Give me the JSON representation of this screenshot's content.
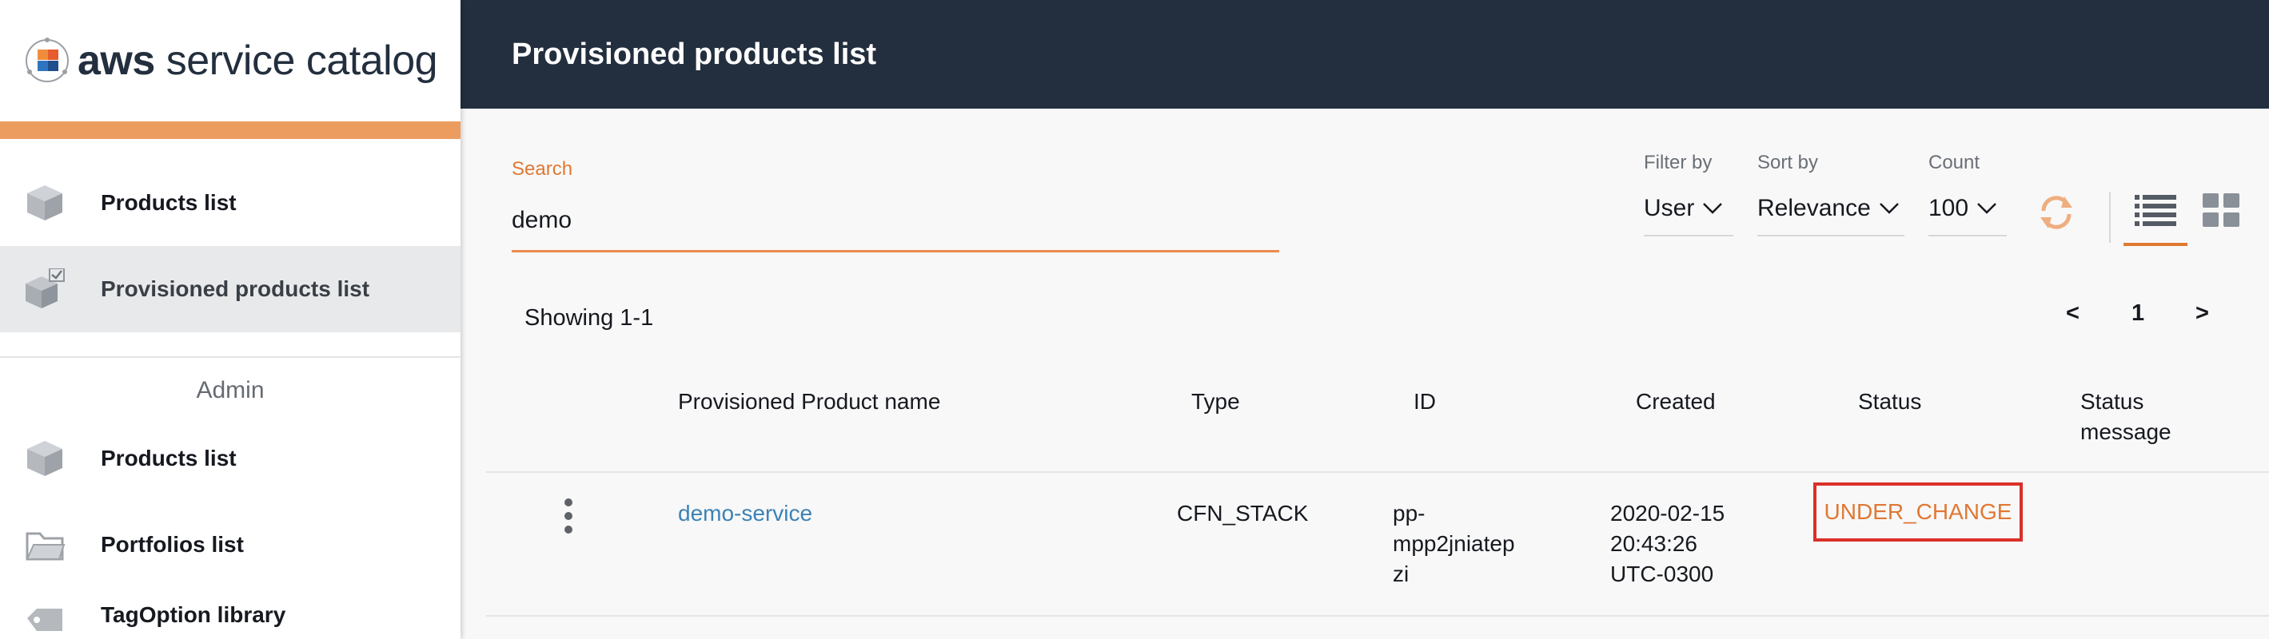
{
  "brand": {
    "bold": "aws",
    "rest": " service catalog"
  },
  "sidebar": {
    "items": [
      {
        "label": "Products list",
        "icon": "box-icon"
      },
      {
        "label": "Provisioned products list",
        "icon": "provisioned-box-icon"
      }
    ],
    "admin_label": "Admin",
    "admin_items": [
      {
        "label": "Products list",
        "icon": "box-icon"
      },
      {
        "label": "Portfolios list",
        "icon": "folder-icon"
      },
      {
        "label": "TagOption library",
        "icon": "tag-icon"
      }
    ]
  },
  "header": {
    "title": "Provisioned products list"
  },
  "search": {
    "label": "Search",
    "value": "demo"
  },
  "filters": {
    "filter_by": {
      "label": "Filter by",
      "value": "User"
    },
    "sort_by": {
      "label": "Sort by",
      "value": "Relevance"
    },
    "count": {
      "label": "Count",
      "value": "100"
    }
  },
  "results": {
    "showing": "Showing 1-1"
  },
  "pagination": {
    "prev": "<",
    "page": "1",
    "next": ">"
  },
  "table": {
    "headers": {
      "name": "Provisioned Product name",
      "type": "Type",
      "id": "ID",
      "created": "Created",
      "status": "Status",
      "status_message_1": "Status",
      "status_message_2": "message"
    },
    "rows": [
      {
        "name": "demo-service",
        "type": "CFN_STACK",
        "id_1": "pp-",
        "id_2": "mpp2jniatep",
        "id_3": "zi",
        "created_1": "2020-02-15",
        "created_2": "20:43:26",
        "created_3": "UTC-0300",
        "status": "UNDER_CHANGE",
        "status_message": ""
      }
    ]
  },
  "colors": {
    "header_bg": "#232f3e",
    "accent_orange": "#e07833",
    "link_blue": "#3b82b6",
    "highlight_red": "#d9302a"
  }
}
